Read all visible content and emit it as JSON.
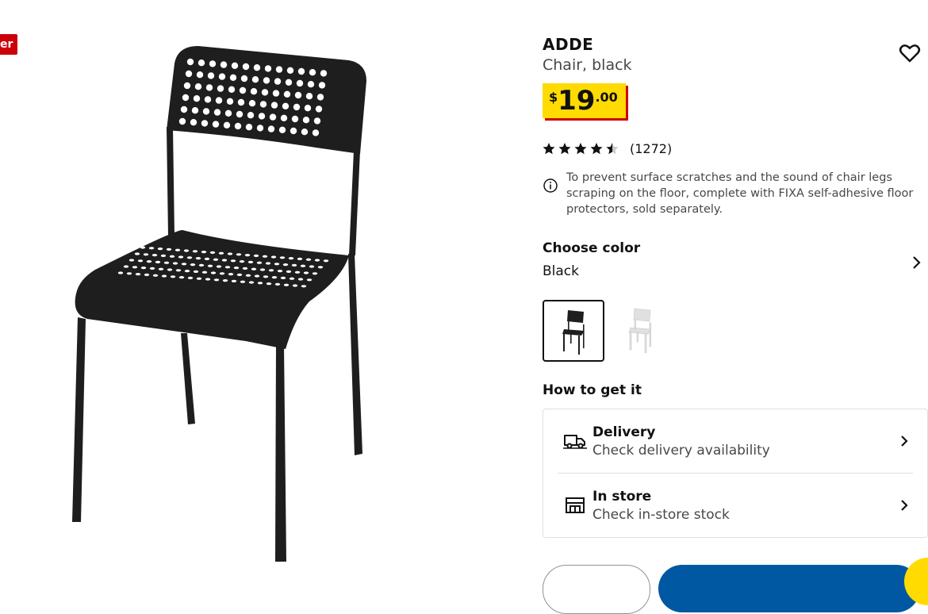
{
  "badge": {
    "label": "er"
  },
  "product": {
    "name": "ADDE",
    "description": "Chair, black",
    "price": {
      "currency": "$",
      "integer": "19",
      "decimal": ".00"
    },
    "rating": {
      "stars": 4.5,
      "count": "(1272)"
    },
    "notice": "To prevent surface scratches and the sound of chair legs scraping on the floor, complete with FIXA self-adhesive floor protectors, sold separately."
  },
  "color": {
    "heading": "Choose color",
    "selected": "Black",
    "options": [
      {
        "name": "black",
        "hex": "#111111"
      },
      {
        "name": "white",
        "hex": "#e6e6e6"
      }
    ]
  },
  "fulfillment": {
    "heading": "How to get it",
    "delivery": {
      "title": "Delivery",
      "subtitle": "Check delivery availability"
    },
    "store": {
      "title": "In store",
      "subtitle": "Check in-store stock"
    }
  },
  "colors": {
    "brand_yellow": "#ffdb00",
    "brand_blue": "#0058a3",
    "brand_red": "#cc0008"
  },
  "icons": [
    "heart-icon",
    "star-icon",
    "info-icon",
    "chevron-right-icon",
    "truck-icon",
    "store-icon",
    "chat-icon"
  ]
}
